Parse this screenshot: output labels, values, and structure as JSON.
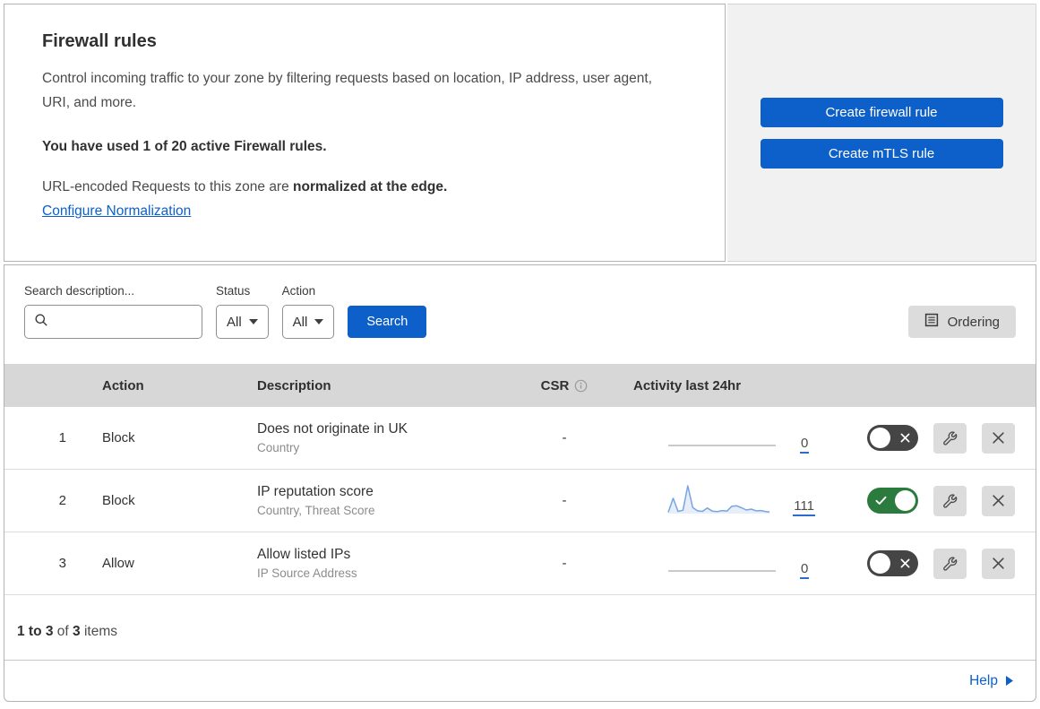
{
  "intro": {
    "title": "Firewall rules",
    "description": "Control incoming traffic to your zone by filtering requests based on location, IP address, user agent, URI, and more.",
    "usage_note": "You have used 1 of 20 active Firewall rules.",
    "normalization_text": "URL-encoded Requests to this zone are",
    "normalization_bold": "normalized at the edge.",
    "normalization_link": "Configure Normalization"
  },
  "actions": {
    "create_firewall_rule": "Create firewall rule",
    "create_mtls_rule": "Create mTLS rule"
  },
  "filters": {
    "search_label": "Search description...",
    "search_value": "",
    "status_label": "Status",
    "status_value": "All",
    "action_label": "Action",
    "action_value": "All",
    "search_button": "Search",
    "ordering_button": "Ordering"
  },
  "table": {
    "headers": {
      "action": "Action",
      "description": "Description",
      "csr": "CSR",
      "activity": "Activity last 24hr"
    },
    "rows": [
      {
        "index": "1",
        "action": "Block",
        "description": "Does not originate in UK",
        "criteria": "Country",
        "csr": "-",
        "activity_count": "0",
        "enabled": false,
        "sparkline": [
          0,
          0,
          0,
          0,
          0,
          0,
          0,
          0,
          0,
          0,
          0,
          0,
          0,
          0,
          0,
          0,
          0,
          0,
          0,
          0
        ]
      },
      {
        "index": "2",
        "action": "Block",
        "description": "IP reputation score",
        "criteria": "Country, Threat Score",
        "csr": "-",
        "activity_count": "111",
        "enabled": true,
        "sparkline": [
          5,
          55,
          8,
          12,
          100,
          22,
          10,
          8,
          20,
          9,
          7,
          11,
          9,
          26,
          28,
          21,
          13,
          16,
          10,
          11,
          7,
          5,
          4
        ]
      },
      {
        "index": "3",
        "action": "Allow",
        "description": "Allow listed IPs",
        "criteria": "IP Source Address",
        "csr": "-",
        "activity_count": "0",
        "enabled": false,
        "sparkline": [
          0,
          0,
          0,
          0,
          0,
          0,
          0,
          0,
          0,
          0,
          0,
          0,
          0,
          0,
          0,
          0,
          0,
          0,
          0,
          0
        ]
      }
    ]
  },
  "footer": {
    "range": "1 to 3",
    "of_label": "of",
    "total": "3",
    "items_label": "items",
    "help_label": "Help"
  },
  "icons": {
    "search": "magnifier",
    "dropdown_caret": "caret-down",
    "ordering": "document-list",
    "csr_info": "info-circle",
    "edit": "wrench",
    "delete": "x",
    "toggle_on_mark": "check",
    "toggle_off_mark": "x",
    "help_arrow": "triangle-right"
  },
  "colors": {
    "accent_blue": "#0d5fc9",
    "toggle_on_green": "#2b7b3f",
    "toggle_off_gray": "#454545",
    "sparkline_line": "#77a5e2",
    "sparkline_fill": "#e7eef9",
    "sparkline_zero_line": "#b9b9b9",
    "table_header_bg": "#d7d7d7"
  }
}
